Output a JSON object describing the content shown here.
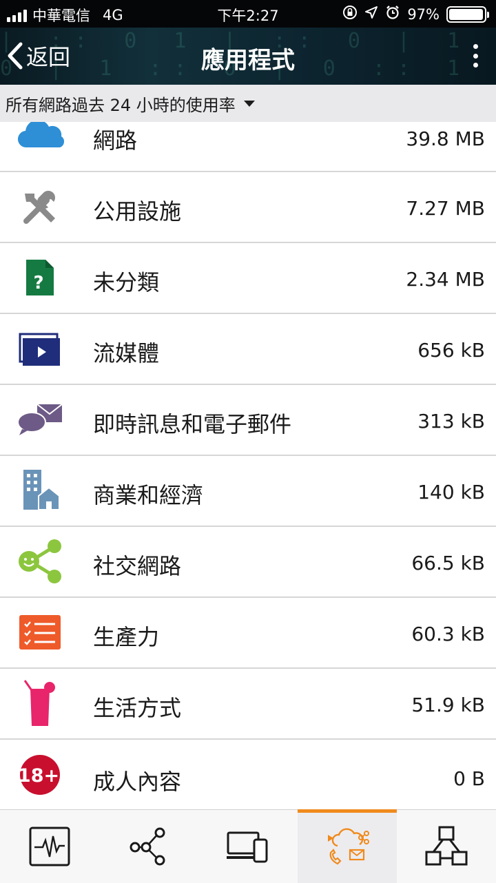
{
  "status_bar": {
    "carrier": "中華電信",
    "network": "4G",
    "time": "下午2:27",
    "battery": "97%",
    "battery_level": 0.97
  },
  "nav": {
    "back_label": "返回",
    "title": "應用程式"
  },
  "filter": {
    "label": "所有網路過去 24 小時的使用率"
  },
  "categories": [
    {
      "name": "網路",
      "size": "39.8 MB",
      "icon": "cloud-icon",
      "color": "#2e8fd6"
    },
    {
      "name": "公用設施",
      "size": "7.27 MB",
      "icon": "tools-icon",
      "color": "#8a8a8a"
    },
    {
      "name": "未分類",
      "size": "2.34 MB",
      "icon": "unknown-file-icon",
      "color": "#157a42"
    },
    {
      "name": "流媒體",
      "size": "656 kB",
      "icon": "video-play-icon",
      "color": "#1f2d7a"
    },
    {
      "name": "即時訊息和電子郵件",
      "size": "313 kB",
      "icon": "chat-mail-icon",
      "color": "#6d5a86"
    },
    {
      "name": "商業和經濟",
      "size": "140 kB",
      "icon": "buildings-icon",
      "color": "#6a93b8"
    },
    {
      "name": "社交網路",
      "size": "66.5 kB",
      "icon": "social-share-icon",
      "color": "#8cc63e"
    },
    {
      "name": "生產力",
      "size": "60.3 kB",
      "icon": "checklist-icon",
      "color": "#ef5a2a"
    },
    {
      "name": "生活方式",
      "size": "51.9 kB",
      "icon": "drink-icon",
      "color": "#e8246b"
    },
    {
      "name": "成人內容",
      "size": "0 B",
      "icon": "adult-18-icon",
      "color": "#c8102e"
    }
  ],
  "tabs": [
    {
      "icon": "activity-monitor-icon",
      "active": false
    },
    {
      "icon": "network-nodes-icon",
      "active": false
    },
    {
      "icon": "devices-icon",
      "active": false
    },
    {
      "icon": "applications-icon",
      "active": true
    },
    {
      "icon": "topology-icon",
      "active": false
    }
  ],
  "colors": {
    "accent": "#f08a1c",
    "filter_bg": "#e9e9ec",
    "header_bg": "#0d2530"
  }
}
